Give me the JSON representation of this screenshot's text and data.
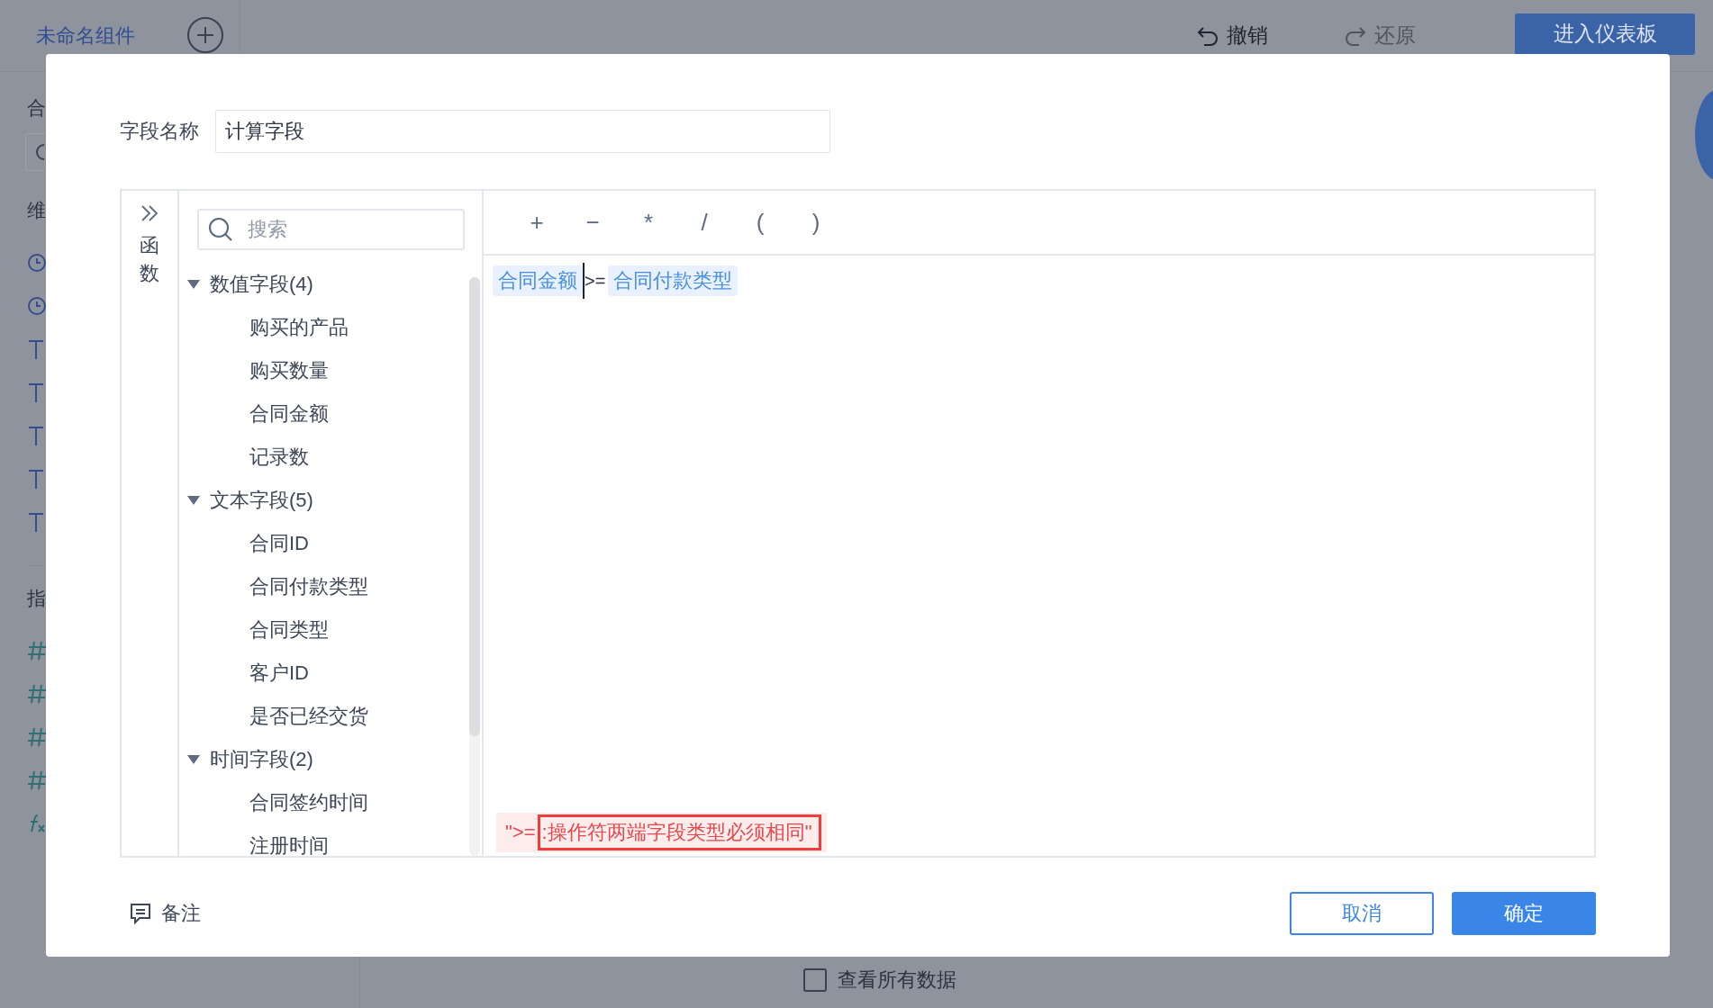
{
  "app_bar": {
    "title": "未命名组件",
    "undo": "撤销",
    "redo": "还原",
    "redo_disabled": true,
    "enter_button": "进入仪表板"
  },
  "side_panel": {
    "headings": [
      "合",
      "维",
      "指"
    ],
    "dimension_fields": [
      {
        "kind": "time"
      },
      {
        "kind": "time"
      },
      {
        "kind": "text"
      },
      {
        "kind": "text"
      },
      {
        "kind": "text"
      },
      {
        "kind": "text"
      },
      {
        "kind": "text"
      }
    ],
    "measure_fields": [
      {
        "kind": "number"
      },
      {
        "kind": "number"
      },
      {
        "kind": "number"
      },
      {
        "kind": "number"
      },
      {
        "kind": "formula"
      }
    ]
  },
  "background_option": {
    "label": "查看所有数据",
    "checked": false
  },
  "dialog": {
    "name_field": {
      "label": "字段名称",
      "value": "计算字段"
    },
    "function_tab": {
      "label": "函数"
    },
    "search": {
      "placeholder": "搜索"
    },
    "field_tree": [
      {
        "label": "数值字段(4)",
        "expanded": true,
        "children": [
          {
            "label": "购买的产品"
          },
          {
            "label": "购买数量"
          },
          {
            "label": "合同金额"
          },
          {
            "label": "记录数"
          }
        ]
      },
      {
        "label": "文本字段(5)",
        "expanded": true,
        "children": [
          {
            "label": "合同ID"
          },
          {
            "label": "合同付款类型"
          },
          {
            "label": "合同类型"
          },
          {
            "label": "客户ID"
          },
          {
            "label": "是否已经交货"
          }
        ]
      },
      {
        "label": "时间字段(2)",
        "expanded": true,
        "children": [
          {
            "label": "合同签约时间"
          },
          {
            "label": "注册时间"
          }
        ]
      }
    ],
    "operators": [
      "+",
      "−",
      "*",
      "/",
      "(",
      ")"
    ],
    "formula": [
      {
        "kind": "field",
        "text": "合同金额"
      },
      {
        "kind": "cursor"
      },
      {
        "kind": "operator",
        "text": ">="
      },
      {
        "kind": "field",
        "text": "合同付款类型"
      }
    ],
    "error": {
      "prefix": "\">=",
      "highlighted_text": ":操作符两端字段类型必须相同\""
    },
    "note": {
      "label": "备注"
    },
    "buttons": [
      {
        "label": "取消",
        "kind": "secondary"
      },
      {
        "label": "确定",
        "kind": "primary"
      }
    ]
  }
}
